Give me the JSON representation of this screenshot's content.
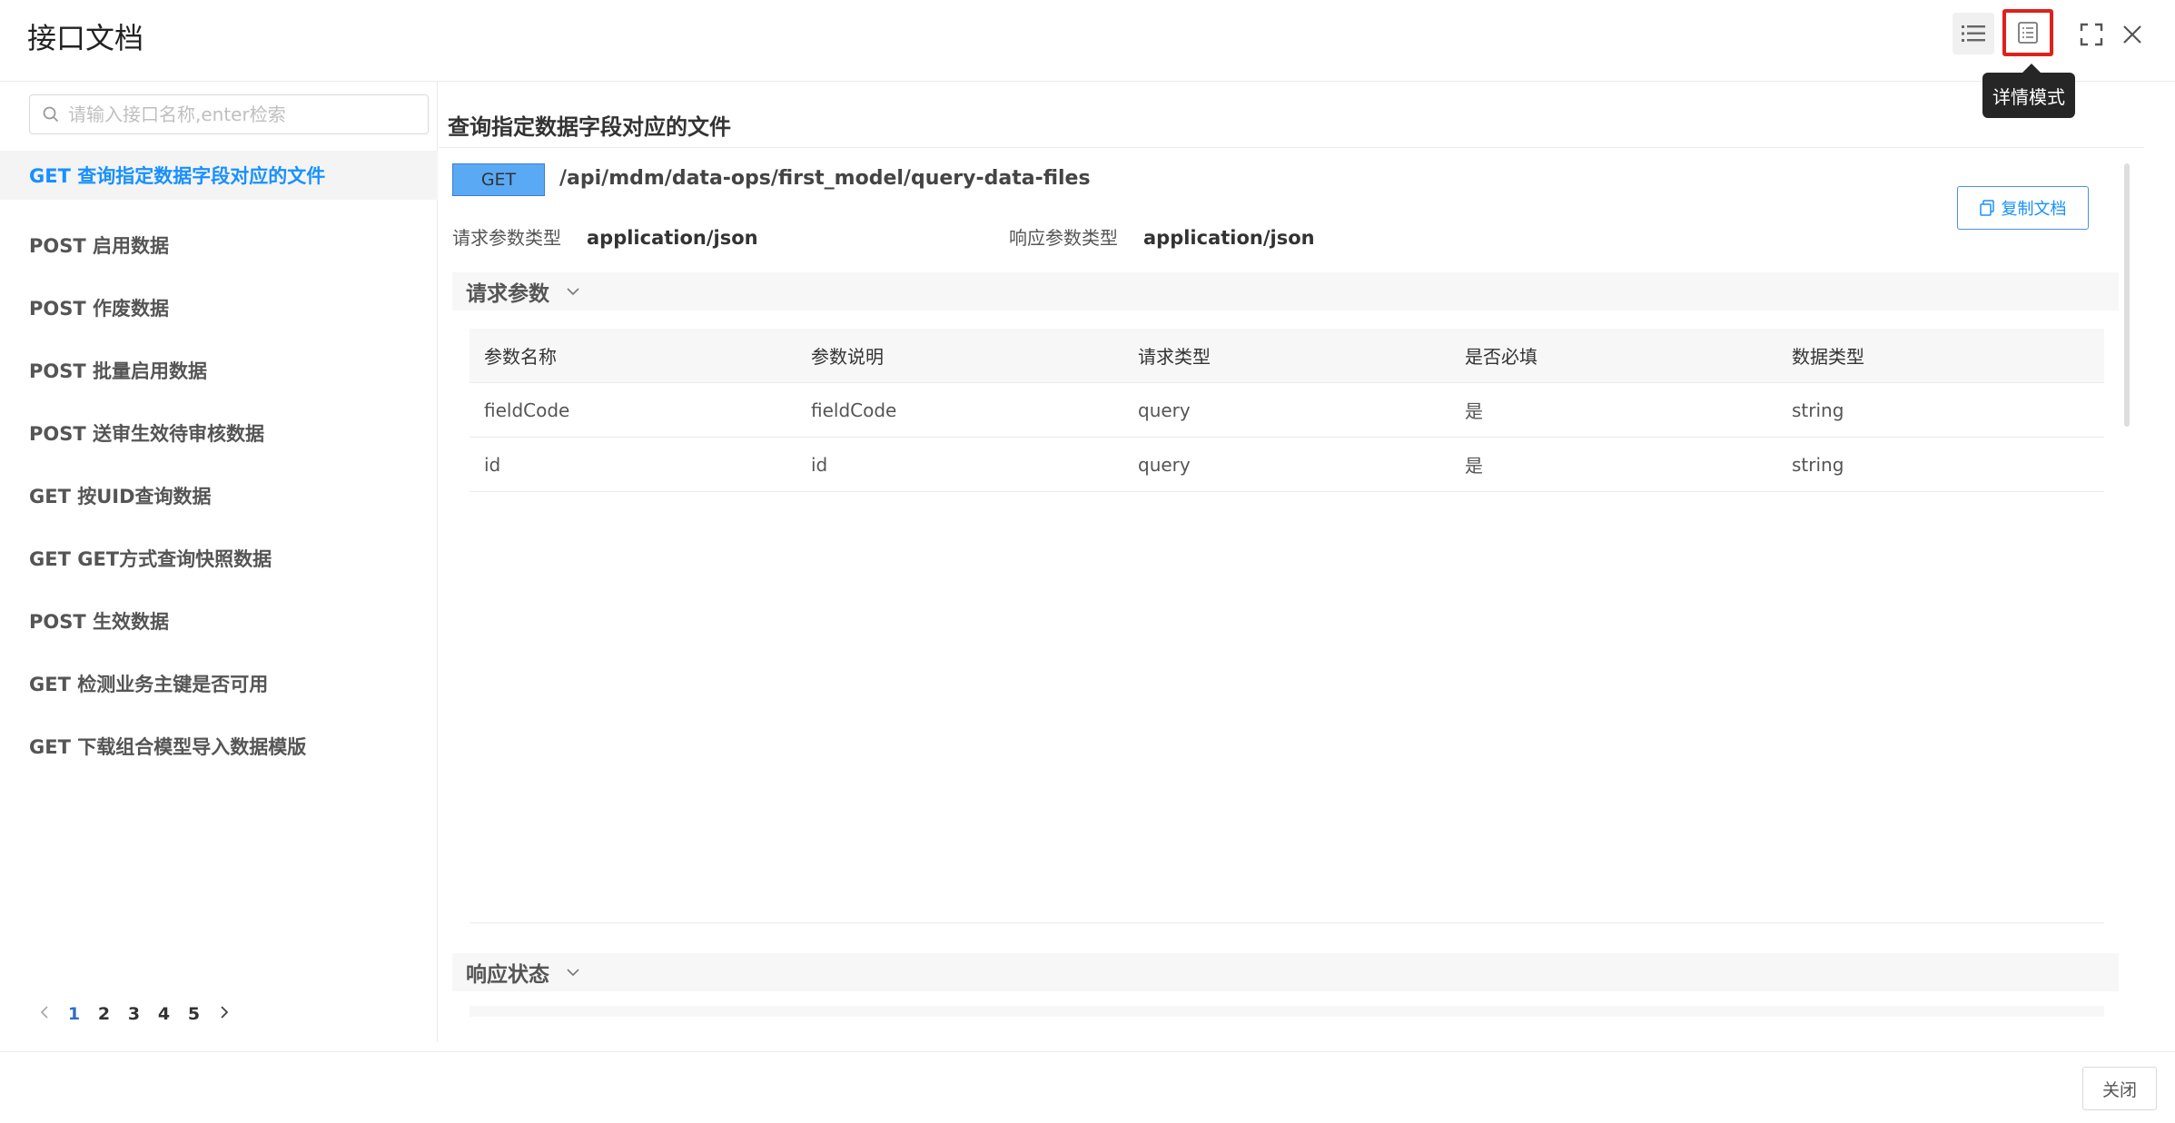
{
  "header": {
    "title": "接口文档",
    "tooltip": "详情模式"
  },
  "search": {
    "placeholder": "请输入接口名称,enter检索"
  },
  "api_list": [
    "GET 查询指定数据字段对应的文件",
    "POST 启用数据",
    "POST 作废数据",
    "POST 批量启用数据",
    "POST 送审生效待审核数据",
    "GET 按UID查询数据",
    "GET GET方式查询快照数据",
    "POST 生效数据",
    "GET 检测业务主键是否可用",
    "GET 下载组合模型导入数据模版"
  ],
  "pager": {
    "pages": [
      "1",
      "2",
      "3",
      "4",
      "5"
    ],
    "current": "1"
  },
  "detail": {
    "title": "查询指定数据字段对应的文件",
    "method": "GET",
    "path": "/api/mdm/data-ops/first_model/query-data-files",
    "copy_label": "复制文档",
    "req_type_label": "请求参数类型",
    "req_type_value": "application/json",
    "resp_type_label": "响应参数类型",
    "resp_type_value": "application/json",
    "request_section": "请求参数",
    "response_section": "响应状态",
    "table": {
      "headers": [
        "参数名称",
        "参数说明",
        "请求类型",
        "是否必填",
        "数据类型"
      ],
      "rows": [
        [
          "fieldCode",
          "fieldCode",
          "query",
          "是",
          "string"
        ],
        [
          "id",
          "id",
          "query",
          "是",
          "string"
        ]
      ]
    }
  },
  "footer": {
    "close_label": "关闭"
  },
  "colors": {
    "accent": "#1890ff",
    "method_bg": "#5aa9f5",
    "highlight": "#e0201b"
  }
}
